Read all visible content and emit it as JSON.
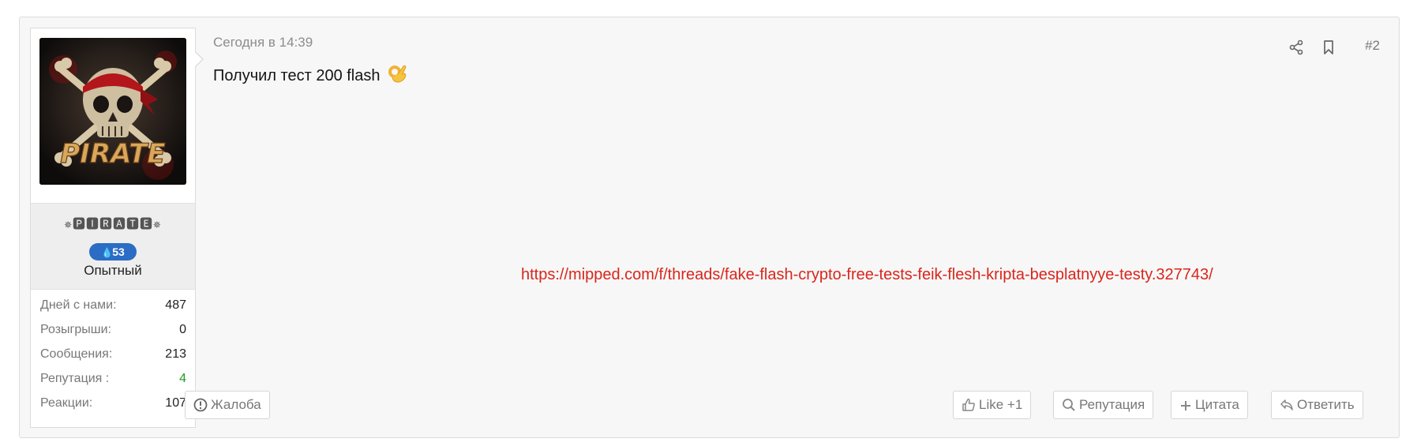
{
  "post": {
    "date": "Сегодня в 14:39",
    "message": "Получил тест 200 flash",
    "emoji": "ok-hand-emoji",
    "link": "https://mipped.com/f/threads/fake-flash-crypto-free-tests-feik-flesh-kripta-besplatnyye-testy.327743/",
    "number": "#2"
  },
  "user": {
    "avatar_text": "PIRATE",
    "username": "✵🅿🅸🆁🅰🆃🅴✵",
    "badge_count": "53",
    "rank": "Опытный",
    "stats": [
      {
        "label": "Дней с нами:",
        "value": "487"
      },
      {
        "label": "Розыгрыши:",
        "value": "0"
      },
      {
        "label": "Сообщения:",
        "value": "213"
      },
      {
        "label": "Репутация :",
        "value": "4"
      },
      {
        "label": "Реакции:",
        "value": "107"
      }
    ]
  },
  "actions": {
    "report": "Жалоба",
    "like": "Like +1",
    "reputation": "Репутация",
    "quote": "Цитата",
    "reply": "Ответить"
  },
  "colors": {
    "link": "#d9261c",
    "badge": "#2b6cc4",
    "reputation_positive": "#1e9e1e"
  }
}
